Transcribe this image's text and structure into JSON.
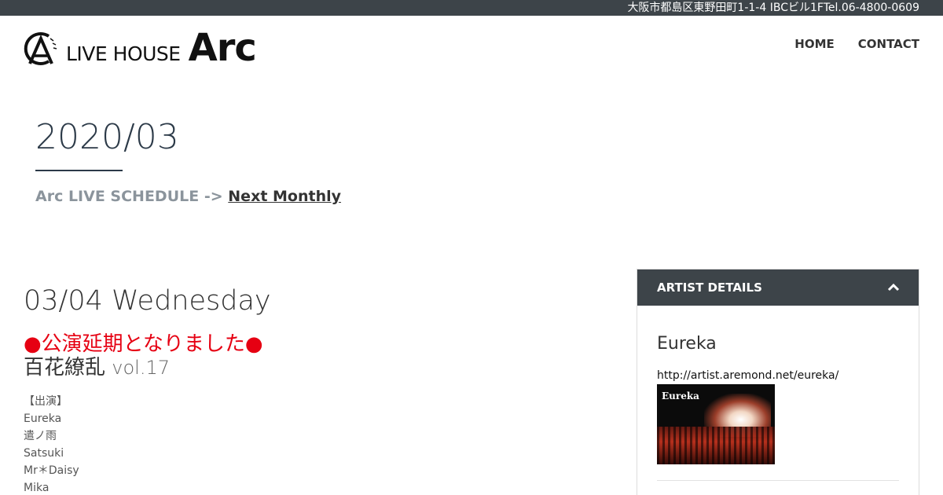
{
  "topbar": {
    "address": "大阪市都島区東野田町1-1-4 IBCビル1FTel.06-4800-0609"
  },
  "logo": {
    "small_text": "LIVE HOUSE",
    "big_text": "Arc",
    "icon": "arc-logo-icon"
  },
  "nav": {
    "home": "HOME",
    "contact": "CONTACT"
  },
  "page": {
    "month": "2020/03",
    "schedule_prefix": "Arc LIVE SCHEDULE ->",
    "next_link": "Next Monthly"
  },
  "event": {
    "date": "03/04 Wednesday",
    "notice": "●公演延期となりました●",
    "title": "百花繚乱",
    "volume": "vol.17",
    "performers_heading": "【出演】",
    "performers": [
      "Eureka",
      "遣ノ雨",
      "Satsuki",
      "Mr＊Daisy",
      "Mika"
    ]
  },
  "artist_panel": {
    "header": "ARTIST DETAILS",
    "toggle_icon": "chevron-up-icon",
    "artist_name": "Eureka",
    "artist_url": "http://artist.aremond.net/eureka/",
    "image_caption": "Eureka"
  }
}
